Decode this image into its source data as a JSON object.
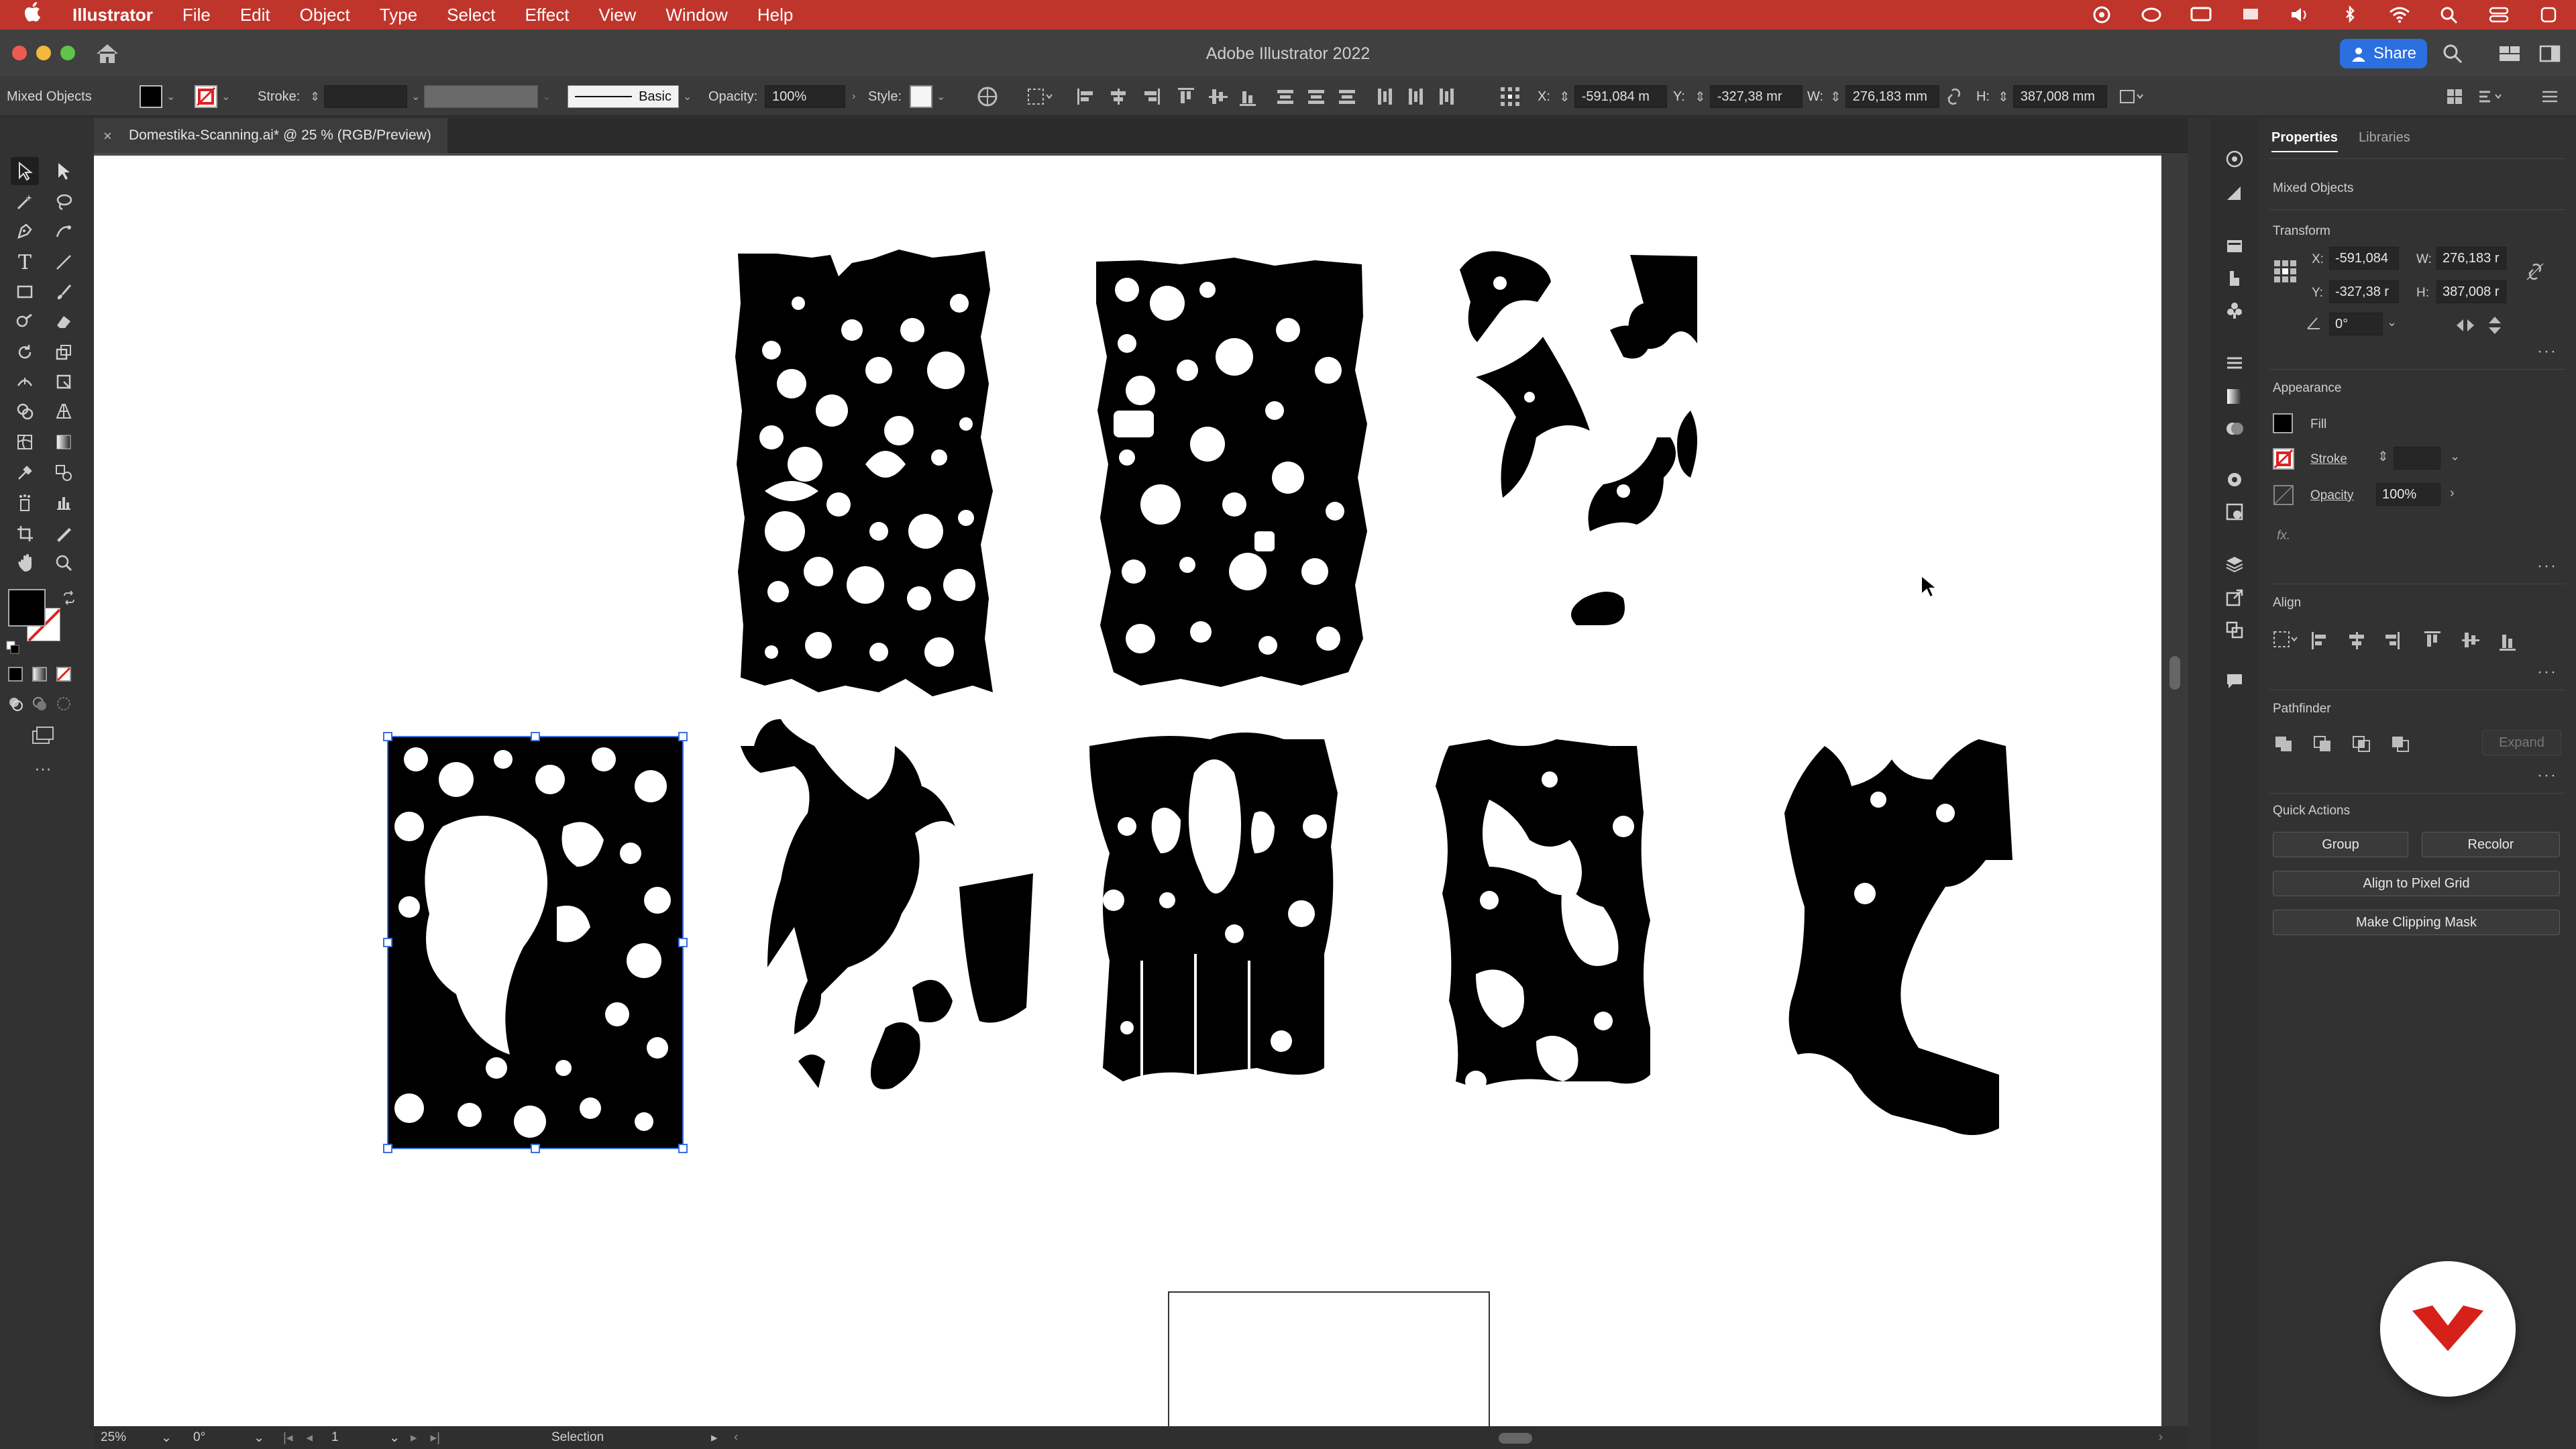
{
  "menubar": {
    "app_name": "Illustrator",
    "items": [
      "File",
      "Edit",
      "Object",
      "Type",
      "Select",
      "Effect",
      "View",
      "Window",
      "Help"
    ]
  },
  "window": {
    "title": "Adobe Illustrator 2022",
    "share_label": "Share"
  },
  "controlbar": {
    "selection_type": "Mixed Objects",
    "stroke_label": "Stroke:",
    "brush_label": "Basic",
    "opacity_label": "Opacity:",
    "opacity_value": "100%",
    "style_label": "Style:",
    "x_label": "X:",
    "x_value": "-591,084 m",
    "y_label": "Y:",
    "y_value": "-327,38 mr",
    "w_label": "W:",
    "w_value": "276,183 mm",
    "h_label": "H:",
    "h_value": "387,008 mm"
  },
  "document_tab": {
    "title": "Domestika-Scanning.ai* @ 25 % (RGB/Preview)"
  },
  "statusbar": {
    "zoom": "25%",
    "rotation": "0°",
    "artboard_number": "1",
    "current_tool": "Selection"
  },
  "properties_panel": {
    "tabs": [
      "Properties",
      "Libraries"
    ],
    "selection_type": "Mixed Objects",
    "transform": {
      "title": "Transform",
      "x_label": "X:",
      "x_value": "-591,084",
      "y_label": "Y:",
      "y_value": "-327,38 r",
      "w_label": "W:",
      "w_value": "276,183 r",
      "h_label": "H:",
      "h_value": "387,008 r",
      "angle_value": "0°"
    },
    "appearance": {
      "title": "Appearance",
      "fill_label": "Fill",
      "stroke_label": "Stroke",
      "opacity_label": "Opacity",
      "opacity_value": "100%",
      "fx_label": "fx."
    },
    "align": {
      "title": "Align"
    },
    "pathfinder": {
      "title": "Pathfinder",
      "expand_label": "Expand"
    },
    "quick_actions": {
      "title": "Quick Actions",
      "group_label": "Group",
      "recolor_label": "Recolor",
      "align_pixel_label": "Align to Pixel Grid",
      "clipping_mask_label": "Make Clipping Mask"
    }
  },
  "colors": {
    "menubar_bg": "#c0352b",
    "share_blue": "#2c6fe0",
    "selection_blue": "#3b6fe0",
    "badge_red": "#d6201a"
  }
}
